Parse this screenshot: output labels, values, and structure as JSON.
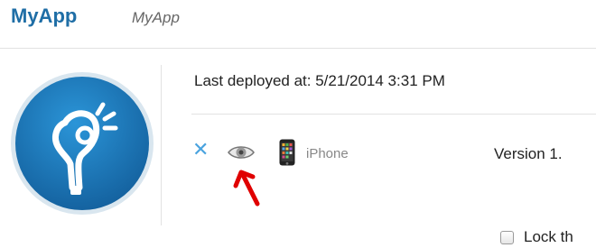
{
  "header": {
    "title": "MyApp",
    "subtitle": "MyApp"
  },
  "icons": {
    "logo": "app-logo-icon",
    "remove": "close-x-icon",
    "preview": "eye-icon",
    "device": "iphone-icon",
    "annotation": "red-arrow-annotation"
  },
  "colors": {
    "brand": "#1f6ea6",
    "logo_bg": "#1f7fc4",
    "remove_x": "#4aa3df",
    "annotation": "#e00000"
  },
  "deployment": {
    "last_deployed": "Last deployed at: 5/21/2014 3:31 PM",
    "platform": "iPhone",
    "version": "Version 1."
  },
  "lock": {
    "label": "Lock th",
    "checked": false
  }
}
